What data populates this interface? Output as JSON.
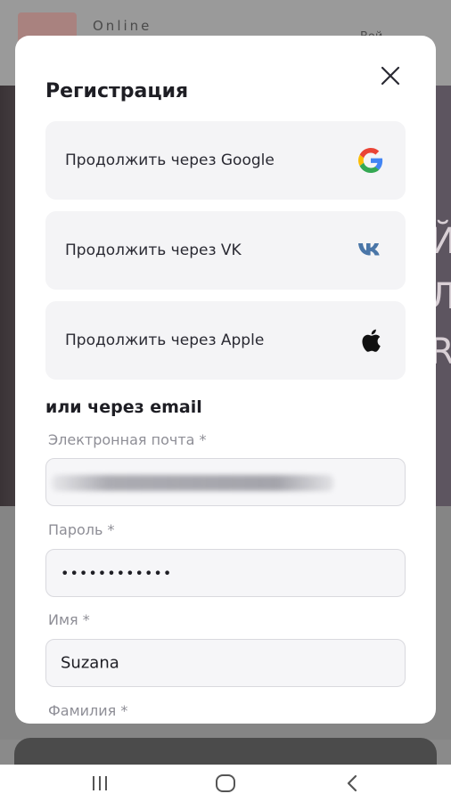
{
  "background": {
    "logo_text": "Online",
    "login_text": "Вой",
    "hero_letters": "Й Л R"
  },
  "modal": {
    "title": "Регистрация",
    "social": [
      {
        "label": "Продолжить через Google",
        "icon": "google-icon"
      },
      {
        "label": "Продолжить через VK",
        "icon": "vk-icon"
      },
      {
        "label": "Продолжить через Apple",
        "icon": "apple-icon"
      }
    ],
    "or_email": "или через email",
    "fields": {
      "email": {
        "label": "Электронная почта *",
        "value": ""
      },
      "password": {
        "label": "Пароль *",
        "value": "••••••••••••"
      },
      "first_name": {
        "label": "Имя *",
        "value": "Suzana"
      },
      "last_name": {
        "label": "Фамилия *"
      }
    }
  },
  "colors": {
    "accent_text": "#1e1e24",
    "button_bg": "#f4f4f6",
    "vk_blue": "#4a76a8",
    "label_grey": "#8e8e96"
  },
  "navbar": {
    "icons": [
      "recents-icon",
      "home-icon",
      "back-icon"
    ]
  }
}
